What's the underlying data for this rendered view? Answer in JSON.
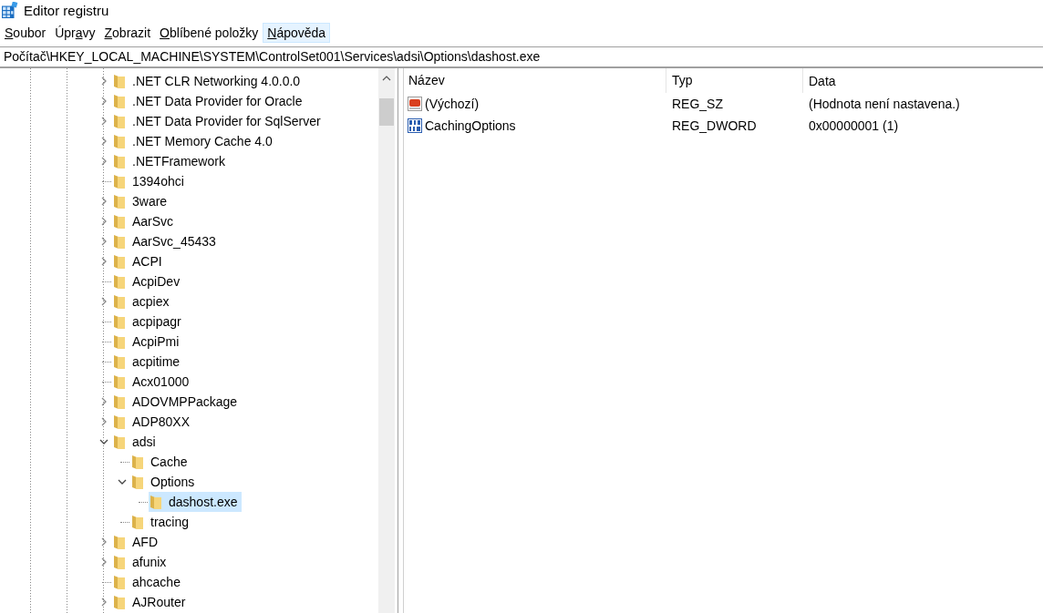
{
  "window": {
    "title": "Editor registru"
  },
  "menu": [
    {
      "key": "S",
      "after": "oubor",
      "highlighted": false
    },
    {
      "before": "Úpr",
      "key": "a",
      "after": "vy",
      "highlighted": false
    },
    {
      "key": "Z",
      "after": "obrazit",
      "highlighted": false
    },
    {
      "key": "O",
      "after": "blíbené položky",
      "highlighted": false
    },
    {
      "key": "N",
      "after": "ápověda",
      "highlighted": true
    }
  ],
  "address": "Počítač\\HKEY_LOCAL_MACHINE\\SYSTEM\\ControlSet001\\Services\\adsi\\Options\\dashost.exe",
  "tree": {
    "items": [
      {
        "label": ".NET CLR Networking 4.0.0.0",
        "expanded": false,
        "selected": false
      },
      {
        "label": ".NET Data Provider for Oracle",
        "expanded": false,
        "selected": false
      },
      {
        "label": ".NET Data Provider for SqlServer",
        "expanded": false,
        "selected": false
      },
      {
        "label": ".NET Memory Cache 4.0",
        "expanded": false,
        "selected": false
      },
      {
        "label": ".NETFramework",
        "expanded": false,
        "selected": false
      },
      {
        "label": "1394ohci",
        "selected": false
      },
      {
        "label": "3ware",
        "expanded": false,
        "selected": false
      },
      {
        "label": "AarSvc",
        "expanded": false,
        "selected": false
      },
      {
        "label": "AarSvc_45433",
        "expanded": false,
        "selected": false
      },
      {
        "label": "ACPI",
        "expanded": false,
        "selected": false
      },
      {
        "label": "AcpiDev",
        "selected": false
      },
      {
        "label": "acpiex",
        "expanded": false,
        "selected": false
      },
      {
        "label": "acpipagr",
        "selected": false
      },
      {
        "label": "AcpiPmi",
        "selected": false
      },
      {
        "label": "acpitime",
        "selected": false
      },
      {
        "label": "Acx01000",
        "selected": false
      },
      {
        "label": "ADOVMPPackage",
        "expanded": false,
        "selected": false
      },
      {
        "label": "ADP80XX",
        "expanded": false,
        "selected": false
      },
      {
        "label": "adsi",
        "expanded": true,
        "selected": false,
        "children": [
          {
            "label": "Cache",
            "selected": false
          },
          {
            "label": "Options",
            "expanded": true,
            "selected": false,
            "children": [
              {
                "label": "dashost.exe",
                "selected": true
              }
            ]
          },
          {
            "label": "tracing",
            "selected": false
          }
        ]
      },
      {
        "label": "AFD",
        "expanded": false,
        "selected": false
      },
      {
        "label": "afunix",
        "expanded": false,
        "selected": false
      },
      {
        "label": "ahcache",
        "selected": false
      },
      {
        "label": "AJRouter",
        "expanded": false,
        "selected": false
      }
    ]
  },
  "values": {
    "columns": [
      "Název",
      "Typ",
      "Data"
    ],
    "rows": [
      {
        "kind": "string",
        "name": "(Výchozí)",
        "type": "REG_SZ",
        "data": "(Hodnota není nastavena.)"
      },
      {
        "kind": "dword",
        "name": "CachingOptions",
        "type": "REG_DWORD",
        "data": "0x00000001 (1)"
      }
    ]
  }
}
